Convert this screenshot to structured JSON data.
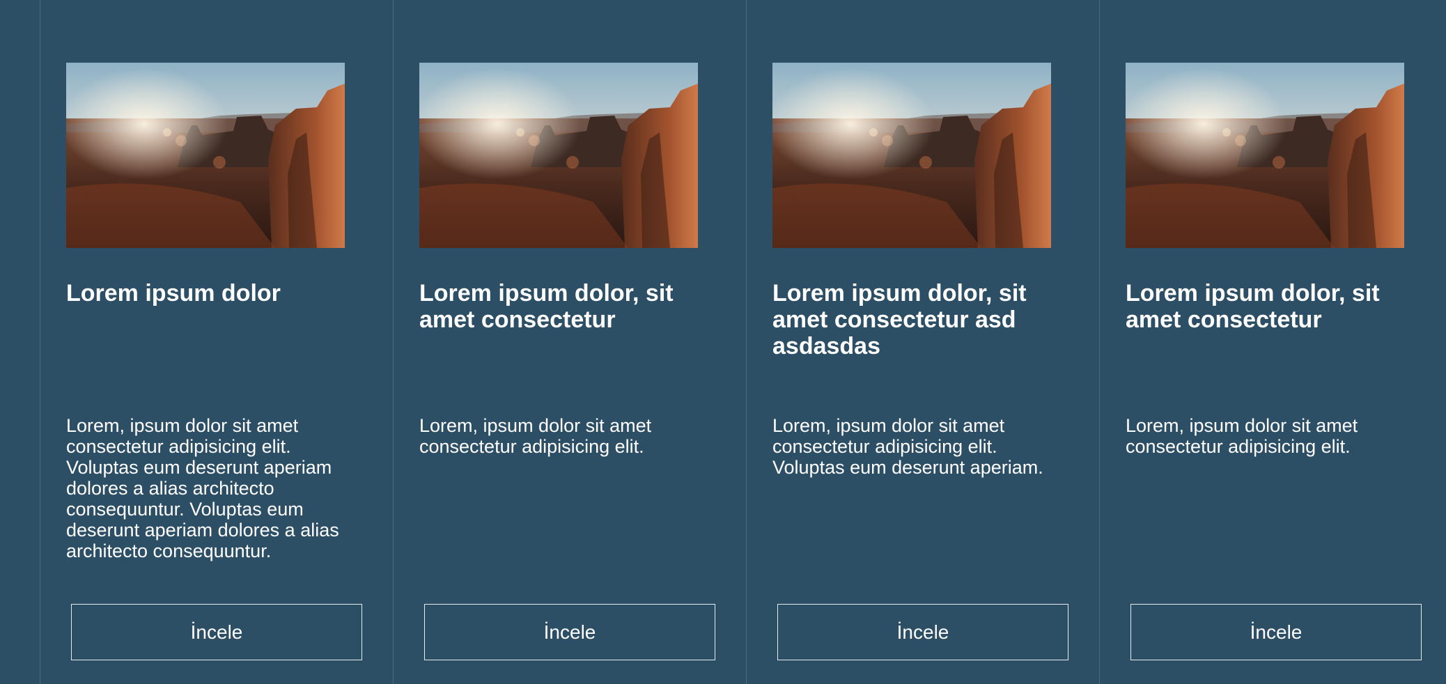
{
  "cards": [
    {
      "image_alt": "canyon-landscape-photo",
      "title": "Lorem ipsum dolor",
      "text": "Lorem, ipsum dolor sit amet consectetur adipisicing elit. Voluptas eum deserunt aperiam dolores a alias architecto consequuntur. Voluptas eum deserunt aperiam dolores a alias architecto consequuntur.",
      "button_label": "İncele"
    },
    {
      "image_alt": "canyon-landscape-photo",
      "title": "Lorem ipsum dolor, sit amet consectetur",
      "text": "Lorem, ipsum dolor sit amet consectetur adipisicing elit.",
      "button_label": "İncele"
    },
    {
      "image_alt": "canyon-landscape-photo",
      "title": "Lorem ipsum dolor, sit amet consectetur asd asdasdas",
      "text": "Lorem, ipsum dolor sit amet consectetur adipisicing elit. Voluptas eum deserunt aperiam.",
      "button_label": "İncele"
    },
    {
      "image_alt": "canyon-landscape-photo",
      "title": "Lorem ipsum dolor, sit amet consectetur",
      "text": "Lorem, ipsum dolor sit amet consectetur adipisicing elit.",
      "button_label": "İncele"
    }
  ],
  "colors": {
    "background": "#2d4f65",
    "divider": "#4b6a80",
    "text": "#ffffff"
  }
}
